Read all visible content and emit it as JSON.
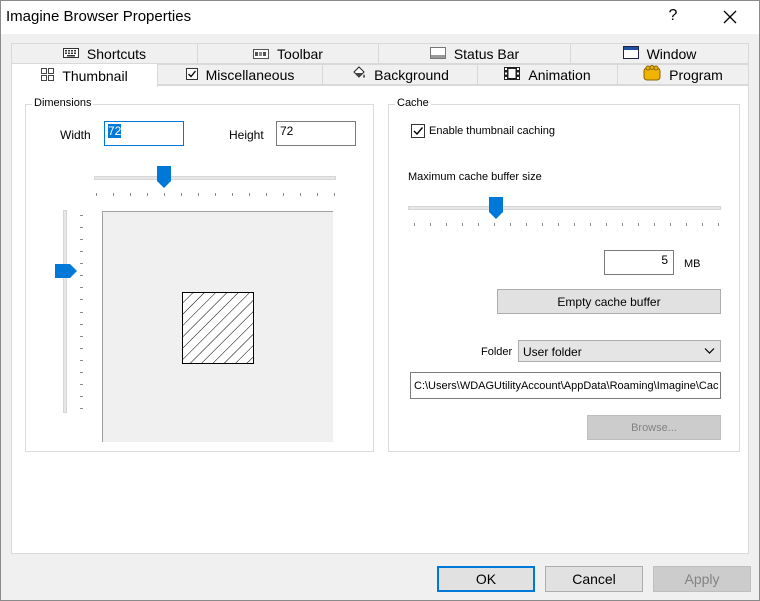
{
  "window": {
    "title": "Imagine Browser Properties",
    "help_glyph": "?"
  },
  "tabs_row1": [
    {
      "label": "Shortcuts",
      "icon": "keyboard-icon"
    },
    {
      "label": "Toolbar",
      "icon": "toolbar-icon"
    },
    {
      "label": "Status Bar",
      "icon": "status-bar-icon"
    },
    {
      "label": "Window",
      "icon": "window-icon"
    }
  ],
  "tabs_row2": [
    {
      "label": "Thumbnail",
      "icon": "thumbnail-grid-icon",
      "active": true
    },
    {
      "label": "Miscellaneous",
      "icon": "checkbox-icon"
    },
    {
      "label": "Background",
      "icon": "paint-bucket-icon"
    },
    {
      "label": "Animation",
      "icon": "film-icon"
    },
    {
      "label": "Program",
      "icon": "program-icon"
    }
  ],
  "dimensions": {
    "group_label": "Dimensions",
    "width_label": "Width",
    "width_value": "72",
    "height_label": "Height",
    "height_value": "72",
    "h_slider_fraction": 0.29,
    "v_slider_fraction": 0.3
  },
  "cache": {
    "group_label": "Cache",
    "enable_label": "Enable thumbnail caching",
    "enable_checked": true,
    "max_label": "Maximum cache buffer size",
    "slider_fraction": 0.28,
    "size_value": "5",
    "size_unit": "MB",
    "empty_button": "Empty cache buffer",
    "folder_label": "Folder",
    "folder_value": "User folder",
    "path_value": "C:\\Users\\WDAGUtilityAccount\\AppData\\Roaming\\Imagine\\Cac",
    "browse_button": "Browse..."
  },
  "footer": {
    "ok": "OK",
    "cancel": "Cancel",
    "apply": "Apply"
  },
  "colors": {
    "accent": "#0078d7",
    "panel": "#ffffff",
    "chrome": "#f0f0f0"
  }
}
